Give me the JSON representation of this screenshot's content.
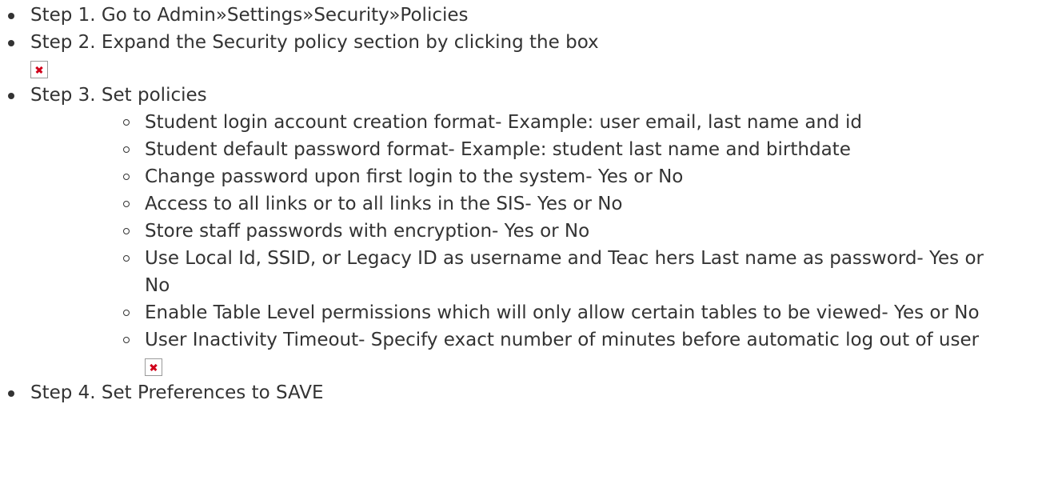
{
  "steps": [
    {
      "text": "Step 1. Go to Admin»Settings»Security»Policies"
    },
    {
      "text": "Step 2. Expand the Security policy section by clicking the box",
      "image_icon": "broken-image-icon"
    },
    {
      "text": "Step 3. Set policies"
    },
    {
      "text": "Step 4. Set Preferences to SAVE"
    }
  ],
  "policies": [
    "Student login account creation format- Example: user email, last name and id",
    "Student default password format- Example: student last name and birthdate",
    "Change password upon first login to the system- Yes or No",
    "Access to all links or to all links in the SIS- Yes or No",
    "Store staff passwords with encryption- Yes or No",
    "Use Local Id, SSID, or Legacy ID as username and Teac hers Last name as password- Yes or No",
    "Enable Table Level permissions which will only allow certain tables to be viewed- Yes or No",
    "User Inactivity Timeout- Specify exact number of minutes before automatic log out of user"
  ],
  "colors": {
    "text": "#333333",
    "broken_image_cross": "#d0021b",
    "broken_image_border": "#9a9a9a"
  }
}
